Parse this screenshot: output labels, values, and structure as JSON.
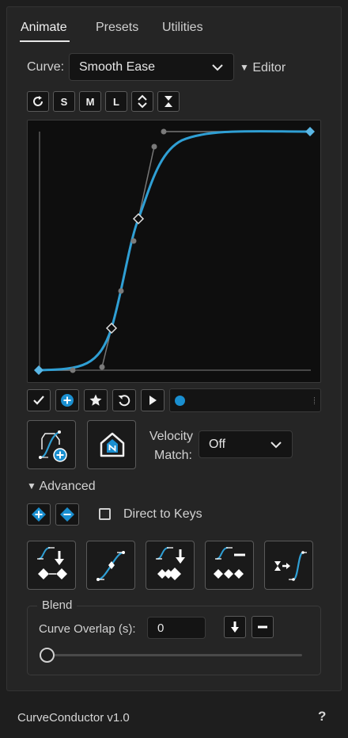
{
  "tabs": [
    {
      "label": "Animate"
    },
    {
      "label": "Presets"
    },
    {
      "label": "Utilities"
    }
  ],
  "curve": {
    "label": "Curve:",
    "selected": "Smooth Ease",
    "editor_toggle": "Editor"
  },
  "toolbar": {
    "buttons": [
      "refresh-icon",
      "S",
      "M",
      "L",
      "expand-icon",
      "collapse-icon"
    ]
  },
  "velocity": {
    "label_line1": "Velocity",
    "label_line2": "Match:",
    "selected": "Off"
  },
  "advanced": {
    "toggle": "Advanced",
    "direct_to_keys": "Direct to Keys"
  },
  "blend": {
    "legend": "Blend",
    "overlap_label": "Curve Overlap (s):",
    "overlap_value": "0",
    "slider_value": 0
  },
  "footer": {
    "version": "CurveConductor v1.0",
    "help": "?"
  },
  "colors": {
    "accent": "#3aa3d9",
    "curve": "#2f9fd4",
    "handle": "#7a7a7a"
  }
}
